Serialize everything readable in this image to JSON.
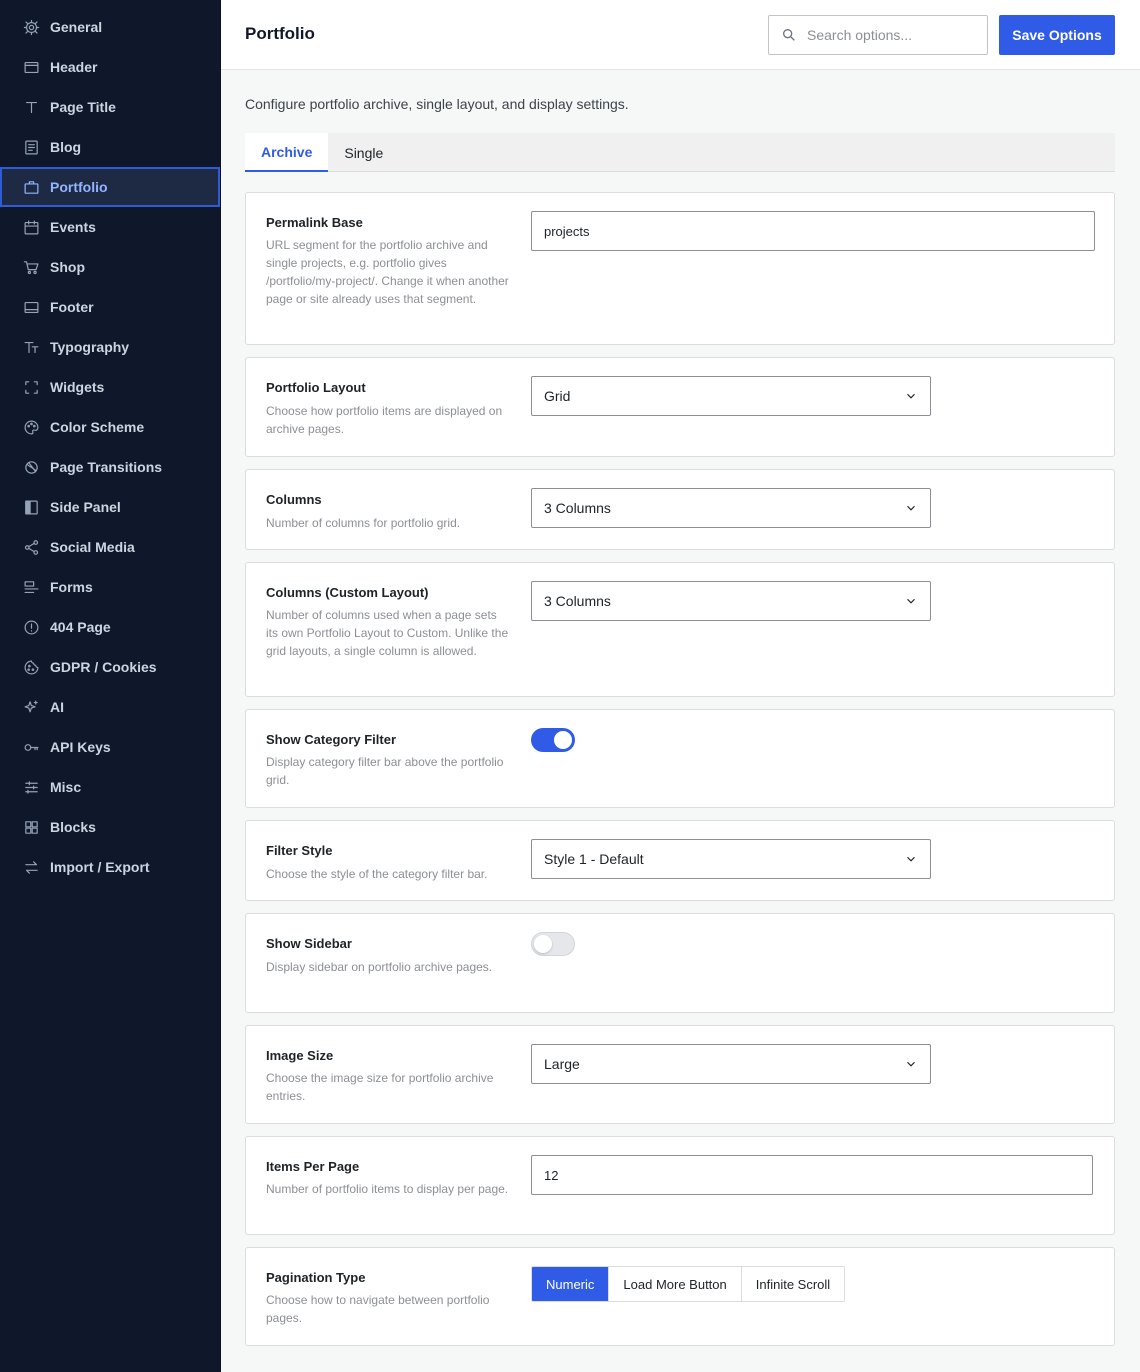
{
  "sidebar": {
    "items": [
      {
        "label": "General",
        "icon": "gear-icon"
      },
      {
        "label": "Header",
        "icon": "window-icon"
      },
      {
        "label": "Page Title",
        "icon": "text-t-icon"
      },
      {
        "label": "Blog",
        "icon": "document-icon"
      },
      {
        "label": "Portfolio",
        "icon": "briefcase-icon",
        "active": true
      },
      {
        "label": "Events",
        "icon": "calendar-icon"
      },
      {
        "label": "Shop",
        "icon": "cart-icon"
      },
      {
        "label": "Footer",
        "icon": "footer-icon"
      },
      {
        "label": "Typography",
        "icon": "typography-icon"
      },
      {
        "label": "Widgets",
        "icon": "widgets-icon"
      },
      {
        "label": "Color Scheme",
        "icon": "palette-icon"
      },
      {
        "label": "Page Transitions",
        "icon": "transition-icon"
      },
      {
        "label": "Side Panel",
        "icon": "side-panel-icon"
      },
      {
        "label": "Social Media",
        "icon": "share-icon"
      },
      {
        "label": "Forms",
        "icon": "forms-icon"
      },
      {
        "label": "404 Page",
        "icon": "alert-circle-icon"
      },
      {
        "label": "GDPR / Cookies",
        "icon": "cookie-icon"
      },
      {
        "label": "AI",
        "icon": "sparkle-icon"
      },
      {
        "label": "API Keys",
        "icon": "key-icon"
      },
      {
        "label": "Misc",
        "icon": "sliders-icon"
      },
      {
        "label": "Blocks",
        "icon": "grid-icon"
      },
      {
        "label": "Import / Export",
        "icon": "swap-icon"
      }
    ]
  },
  "header": {
    "title": "Portfolio",
    "search_placeholder": "Search options...",
    "save_label": "Save Options"
  },
  "main": {
    "description": "Configure portfolio archive, single layout, and display settings.",
    "tabs": [
      {
        "label": "Archive",
        "active": true
      },
      {
        "label": "Single",
        "active": false
      }
    ],
    "fields": {
      "permalink": {
        "label": "Permalink Base",
        "help": "URL segment for the portfolio archive and single projects, e.g. portfolio gives /portfolio/my-project/. Change it when another page or site already uses that segment.",
        "value": "projects"
      },
      "layout": {
        "label": "Portfolio Layout",
        "help": "Choose how portfolio items are displayed on archive pages.",
        "value": "Grid"
      },
      "columns": {
        "label": "Columns",
        "help": "Number of columns for portfolio grid.",
        "value": "3 Columns"
      },
      "columns_custom": {
        "label": "Columns (Custom Layout)",
        "help": "Number of columns used when a page sets its own Portfolio Layout to Custom. Unlike the grid layouts, a single column is allowed.",
        "value": "3 Columns"
      },
      "category_filter": {
        "label": "Show Category Filter",
        "help": "Display category filter bar above the portfolio grid.",
        "enabled": true
      },
      "filter_style": {
        "label": "Filter Style",
        "help": "Choose the style of the category filter bar.",
        "value": "Style 1 - Default"
      },
      "sidebar": {
        "label": "Show Sidebar",
        "help": "Display sidebar on portfolio archive pages.",
        "enabled": false
      },
      "image_size": {
        "label": "Image Size",
        "help": "Choose the image size for portfolio archive entries.",
        "value": "Large"
      },
      "items_per_page": {
        "label": "Items Per Page",
        "help": "Number of portfolio items to display per page.",
        "value": "12"
      },
      "pagination": {
        "label": "Pagination Type",
        "help": "Choose how to navigate between portfolio pages.",
        "options": [
          "Numeric",
          "Load More Button",
          "Infinite Scroll"
        ],
        "selected": "Numeric"
      }
    }
  },
  "colors": {
    "accent": "#2f5be7",
    "sidebar_bg": "#0f172a"
  }
}
